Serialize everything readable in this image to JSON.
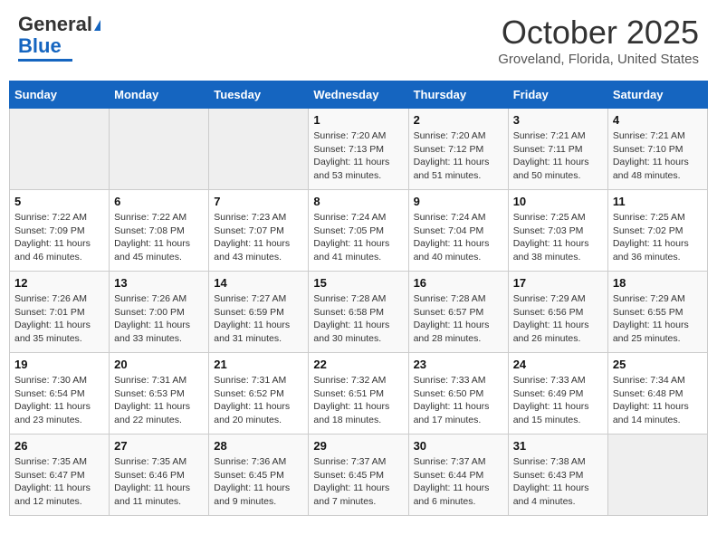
{
  "header": {
    "logo_line1": "General",
    "logo_line2": "Blue",
    "month": "October 2025",
    "location": "Groveland, Florida, United States"
  },
  "weekdays": [
    "Sunday",
    "Monday",
    "Tuesday",
    "Wednesday",
    "Thursday",
    "Friday",
    "Saturday"
  ],
  "weeks": [
    [
      {
        "day": "",
        "sunrise": "",
        "sunset": "",
        "daylight": ""
      },
      {
        "day": "",
        "sunrise": "",
        "sunset": "",
        "daylight": ""
      },
      {
        "day": "",
        "sunrise": "",
        "sunset": "",
        "daylight": ""
      },
      {
        "day": "1",
        "sunrise": "Sunrise: 7:20 AM",
        "sunset": "Sunset: 7:13 PM",
        "daylight": "Daylight: 11 hours and 53 minutes."
      },
      {
        "day": "2",
        "sunrise": "Sunrise: 7:20 AM",
        "sunset": "Sunset: 7:12 PM",
        "daylight": "Daylight: 11 hours and 51 minutes."
      },
      {
        "day": "3",
        "sunrise": "Sunrise: 7:21 AM",
        "sunset": "Sunset: 7:11 PM",
        "daylight": "Daylight: 11 hours and 50 minutes."
      },
      {
        "day": "4",
        "sunrise": "Sunrise: 7:21 AM",
        "sunset": "Sunset: 7:10 PM",
        "daylight": "Daylight: 11 hours and 48 minutes."
      }
    ],
    [
      {
        "day": "5",
        "sunrise": "Sunrise: 7:22 AM",
        "sunset": "Sunset: 7:09 PM",
        "daylight": "Daylight: 11 hours and 46 minutes."
      },
      {
        "day": "6",
        "sunrise": "Sunrise: 7:22 AM",
        "sunset": "Sunset: 7:08 PM",
        "daylight": "Daylight: 11 hours and 45 minutes."
      },
      {
        "day": "7",
        "sunrise": "Sunrise: 7:23 AM",
        "sunset": "Sunset: 7:07 PM",
        "daylight": "Daylight: 11 hours and 43 minutes."
      },
      {
        "day": "8",
        "sunrise": "Sunrise: 7:24 AM",
        "sunset": "Sunset: 7:05 PM",
        "daylight": "Daylight: 11 hours and 41 minutes."
      },
      {
        "day": "9",
        "sunrise": "Sunrise: 7:24 AM",
        "sunset": "Sunset: 7:04 PM",
        "daylight": "Daylight: 11 hours and 40 minutes."
      },
      {
        "day": "10",
        "sunrise": "Sunrise: 7:25 AM",
        "sunset": "Sunset: 7:03 PM",
        "daylight": "Daylight: 11 hours and 38 minutes."
      },
      {
        "day": "11",
        "sunrise": "Sunrise: 7:25 AM",
        "sunset": "Sunset: 7:02 PM",
        "daylight": "Daylight: 11 hours and 36 minutes."
      }
    ],
    [
      {
        "day": "12",
        "sunrise": "Sunrise: 7:26 AM",
        "sunset": "Sunset: 7:01 PM",
        "daylight": "Daylight: 11 hours and 35 minutes."
      },
      {
        "day": "13",
        "sunrise": "Sunrise: 7:26 AM",
        "sunset": "Sunset: 7:00 PM",
        "daylight": "Daylight: 11 hours and 33 minutes."
      },
      {
        "day": "14",
        "sunrise": "Sunrise: 7:27 AM",
        "sunset": "Sunset: 6:59 PM",
        "daylight": "Daylight: 11 hours and 31 minutes."
      },
      {
        "day": "15",
        "sunrise": "Sunrise: 7:28 AM",
        "sunset": "Sunset: 6:58 PM",
        "daylight": "Daylight: 11 hours and 30 minutes."
      },
      {
        "day": "16",
        "sunrise": "Sunrise: 7:28 AM",
        "sunset": "Sunset: 6:57 PM",
        "daylight": "Daylight: 11 hours and 28 minutes."
      },
      {
        "day": "17",
        "sunrise": "Sunrise: 7:29 AM",
        "sunset": "Sunset: 6:56 PM",
        "daylight": "Daylight: 11 hours and 26 minutes."
      },
      {
        "day": "18",
        "sunrise": "Sunrise: 7:29 AM",
        "sunset": "Sunset: 6:55 PM",
        "daylight": "Daylight: 11 hours and 25 minutes."
      }
    ],
    [
      {
        "day": "19",
        "sunrise": "Sunrise: 7:30 AM",
        "sunset": "Sunset: 6:54 PM",
        "daylight": "Daylight: 11 hours and 23 minutes."
      },
      {
        "day": "20",
        "sunrise": "Sunrise: 7:31 AM",
        "sunset": "Sunset: 6:53 PM",
        "daylight": "Daylight: 11 hours and 22 minutes."
      },
      {
        "day": "21",
        "sunrise": "Sunrise: 7:31 AM",
        "sunset": "Sunset: 6:52 PM",
        "daylight": "Daylight: 11 hours and 20 minutes."
      },
      {
        "day": "22",
        "sunrise": "Sunrise: 7:32 AM",
        "sunset": "Sunset: 6:51 PM",
        "daylight": "Daylight: 11 hours and 18 minutes."
      },
      {
        "day": "23",
        "sunrise": "Sunrise: 7:33 AM",
        "sunset": "Sunset: 6:50 PM",
        "daylight": "Daylight: 11 hours and 17 minutes."
      },
      {
        "day": "24",
        "sunrise": "Sunrise: 7:33 AM",
        "sunset": "Sunset: 6:49 PM",
        "daylight": "Daylight: 11 hours and 15 minutes."
      },
      {
        "day": "25",
        "sunrise": "Sunrise: 7:34 AM",
        "sunset": "Sunset: 6:48 PM",
        "daylight": "Daylight: 11 hours and 14 minutes."
      }
    ],
    [
      {
        "day": "26",
        "sunrise": "Sunrise: 7:35 AM",
        "sunset": "Sunset: 6:47 PM",
        "daylight": "Daylight: 11 hours and 12 minutes."
      },
      {
        "day": "27",
        "sunrise": "Sunrise: 7:35 AM",
        "sunset": "Sunset: 6:46 PM",
        "daylight": "Daylight: 11 hours and 11 minutes."
      },
      {
        "day": "28",
        "sunrise": "Sunrise: 7:36 AM",
        "sunset": "Sunset: 6:45 PM",
        "daylight": "Daylight: 11 hours and 9 minutes."
      },
      {
        "day": "29",
        "sunrise": "Sunrise: 7:37 AM",
        "sunset": "Sunset: 6:45 PM",
        "daylight": "Daylight: 11 hours and 7 minutes."
      },
      {
        "day": "30",
        "sunrise": "Sunrise: 7:37 AM",
        "sunset": "Sunset: 6:44 PM",
        "daylight": "Daylight: 11 hours and 6 minutes."
      },
      {
        "day": "31",
        "sunrise": "Sunrise: 7:38 AM",
        "sunset": "Sunset: 6:43 PM",
        "daylight": "Daylight: 11 hours and 4 minutes."
      },
      {
        "day": "",
        "sunrise": "",
        "sunset": "",
        "daylight": ""
      }
    ]
  ]
}
